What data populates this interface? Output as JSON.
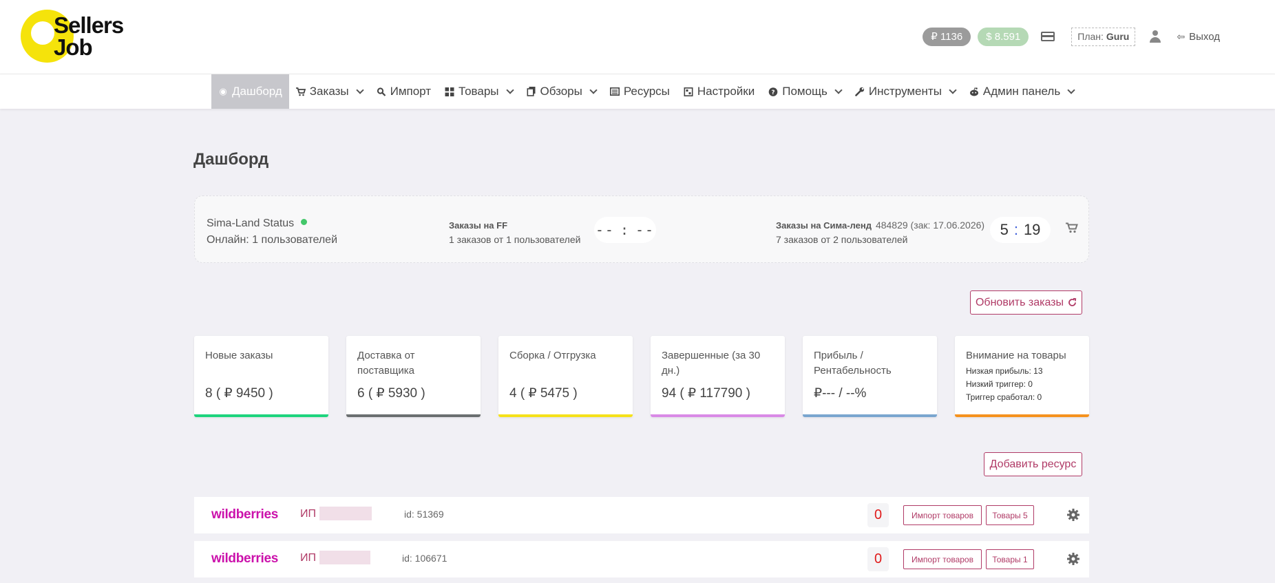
{
  "brand": {
    "line1": "Sellers",
    "line2": "Job"
  },
  "header": {
    "balance_rub": "₽ 1136",
    "balance_usd": "$ 8.591",
    "plan_label": "План:",
    "plan_value": "Guru",
    "logout": "Выход"
  },
  "nav": {
    "dashboard": "Дашборд",
    "orders": "Заказы",
    "import": "Импорт",
    "products": "Товары",
    "reviews": "Обзоры",
    "resources": "Ресурсы",
    "settings": "Настройки",
    "help": "Помощь",
    "tools": "Инструменты",
    "admin": "Админ панель"
  },
  "page": {
    "title": "Дашборд"
  },
  "status": {
    "sima_status": "Sima-Land Status",
    "online": "Онлайн: 1 пользователей",
    "ff_label": "Заказы на FF",
    "ff_sub": "1 заказов от 1 пользователей",
    "ff_timer_h": "--",
    "ff_timer_m": "--",
    "sima_label": "Заказы на Сима-ленд",
    "sima_info": "484829 (зак: 17.06.2026)",
    "sima_sub": "7 заказов от 2 пользователей",
    "sima_timer_h": "5",
    "sima_timer_m": "19"
  },
  "buttons": {
    "refresh_orders": "Обновить заказы",
    "add_resource": "Добавить ресурс"
  },
  "stats": [
    {
      "title": "Новые заказы",
      "value": "8 ( ₽ 9450 )",
      "color": "#1ed47d"
    },
    {
      "title": "Доставка от поставщика",
      "value": "6 ( ₽ 5930 )",
      "color": "#6b6f70"
    },
    {
      "title": "Сборка / Отгрузка",
      "value": "4 ( ₽ 5475 )",
      "color": "#f5e11a"
    },
    {
      "title": "Завершенные (за 30 дн.)",
      "value": "94 ( ₽ 117790 )",
      "color": "#d98ae6"
    },
    {
      "title": "Прибыль / Рентабельность",
      "value": "₽--- / --%",
      "color": "#7aa6cf"
    },
    {
      "title": "Внимание на товары",
      "low_profit": "Низкая прибыль: 13",
      "low_trigger": "Низкий триггер: 0",
      "trigger_fired": "Триггер сработал: 0",
      "color": "#f5921e"
    }
  ],
  "resources": [
    {
      "brand": "wildberries",
      "owner": "ИП",
      "id": "id: 51369",
      "count": "0",
      "import_btn": "Импорт товаров",
      "products_btn": "Товары 5"
    },
    {
      "brand": "wildberries",
      "owner": "ИП",
      "id": "id: 106671",
      "count": "0",
      "import_btn": "Импорт товаров",
      "products_btn": "Товары 1"
    }
  ]
}
